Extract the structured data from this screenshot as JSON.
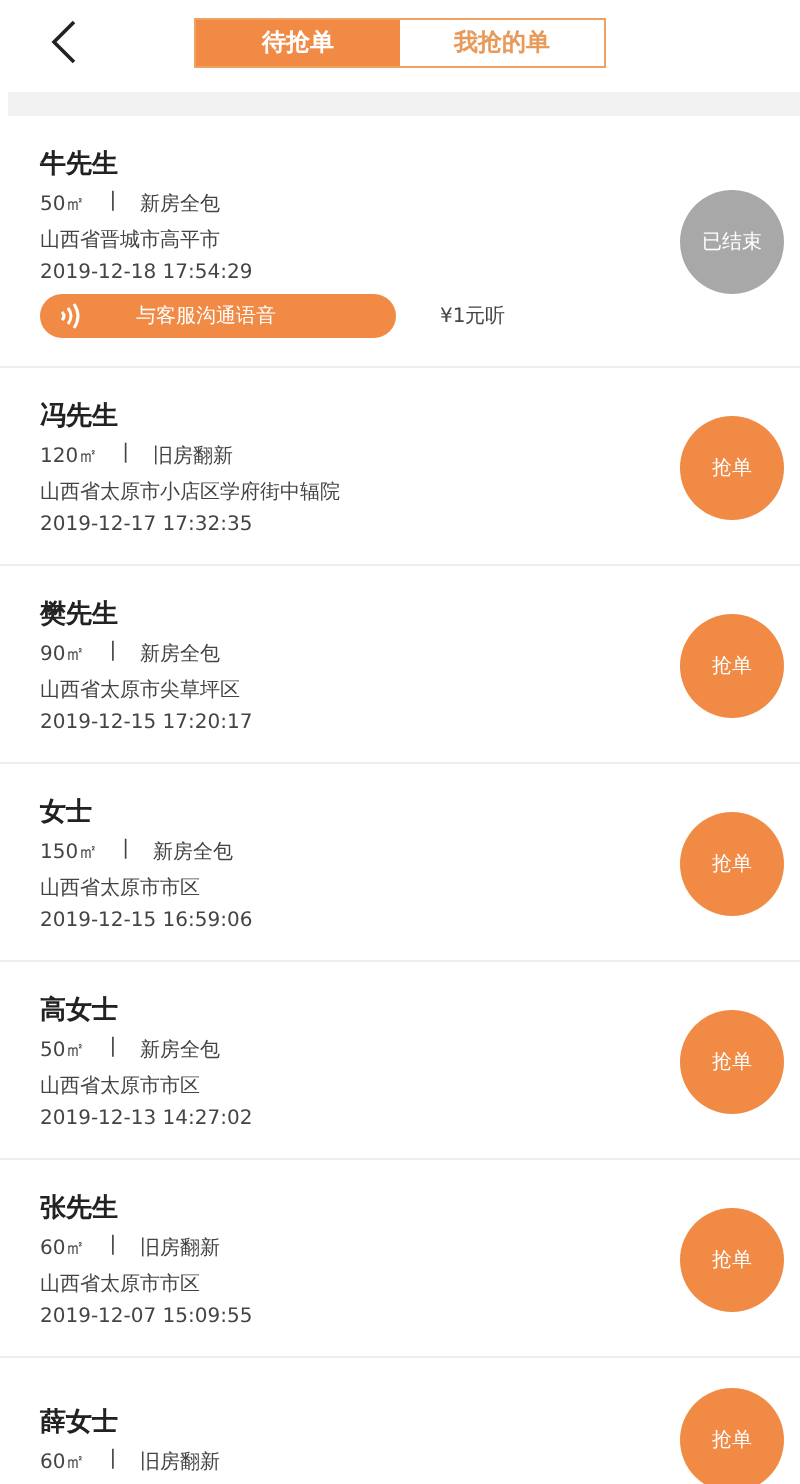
{
  "tabs": [
    {
      "label": "待抢单",
      "selected": true
    },
    {
      "label": "我抢的单",
      "selected": false
    }
  ],
  "orders": [
    {
      "name": "牛先生",
      "area": "50㎡",
      "separator": "|",
      "type": "新房全包",
      "address": "山西省晋城市高平市",
      "time": "2019-12-18 17:54:29",
      "action": {
        "kind": "ended",
        "label": "已结束"
      },
      "voice": {
        "label": "与客服沟通语音",
        "price": "¥1元听"
      }
    },
    {
      "name": "冯先生",
      "area": "120㎡",
      "separator": "|",
      "type": "旧房翻新",
      "address": "山西省太原市小店区学府街中辐院",
      "time": "2019-12-17 17:32:35",
      "action": {
        "kind": "grab",
        "label": "抢单"
      }
    },
    {
      "name": "樊先生",
      "area": "90㎡",
      "separator": "|",
      "type": "新房全包",
      "address": "山西省太原市尖草坪区",
      "time": "2019-12-15 17:20:17",
      "action": {
        "kind": "grab",
        "label": "抢单"
      }
    },
    {
      "name": "女士",
      "area": "150㎡",
      "separator": "|",
      "type": "新房全包",
      "address": "山西省太原市市区",
      "time": "2019-12-15 16:59:06",
      "action": {
        "kind": "grab",
        "label": "抢单"
      }
    },
    {
      "name": "高女士",
      "area": "50㎡",
      "separator": "|",
      "type": "新房全包",
      "address": "山西省太原市市区",
      "time": "2019-12-13 14:27:02",
      "action": {
        "kind": "grab",
        "label": "抢单"
      }
    },
    {
      "name": "张先生",
      "area": "60㎡",
      "separator": "|",
      "type": "旧房翻新",
      "address": "山西省太原市市区",
      "time": "2019-12-07 15:09:55",
      "action": {
        "kind": "grab",
        "label": "抢单"
      }
    },
    {
      "name": "薛女士",
      "area": "60㎡",
      "separator": "|",
      "type": "旧房翻新",
      "action": {
        "kind": "grab",
        "label": "抢单"
      }
    }
  ]
}
